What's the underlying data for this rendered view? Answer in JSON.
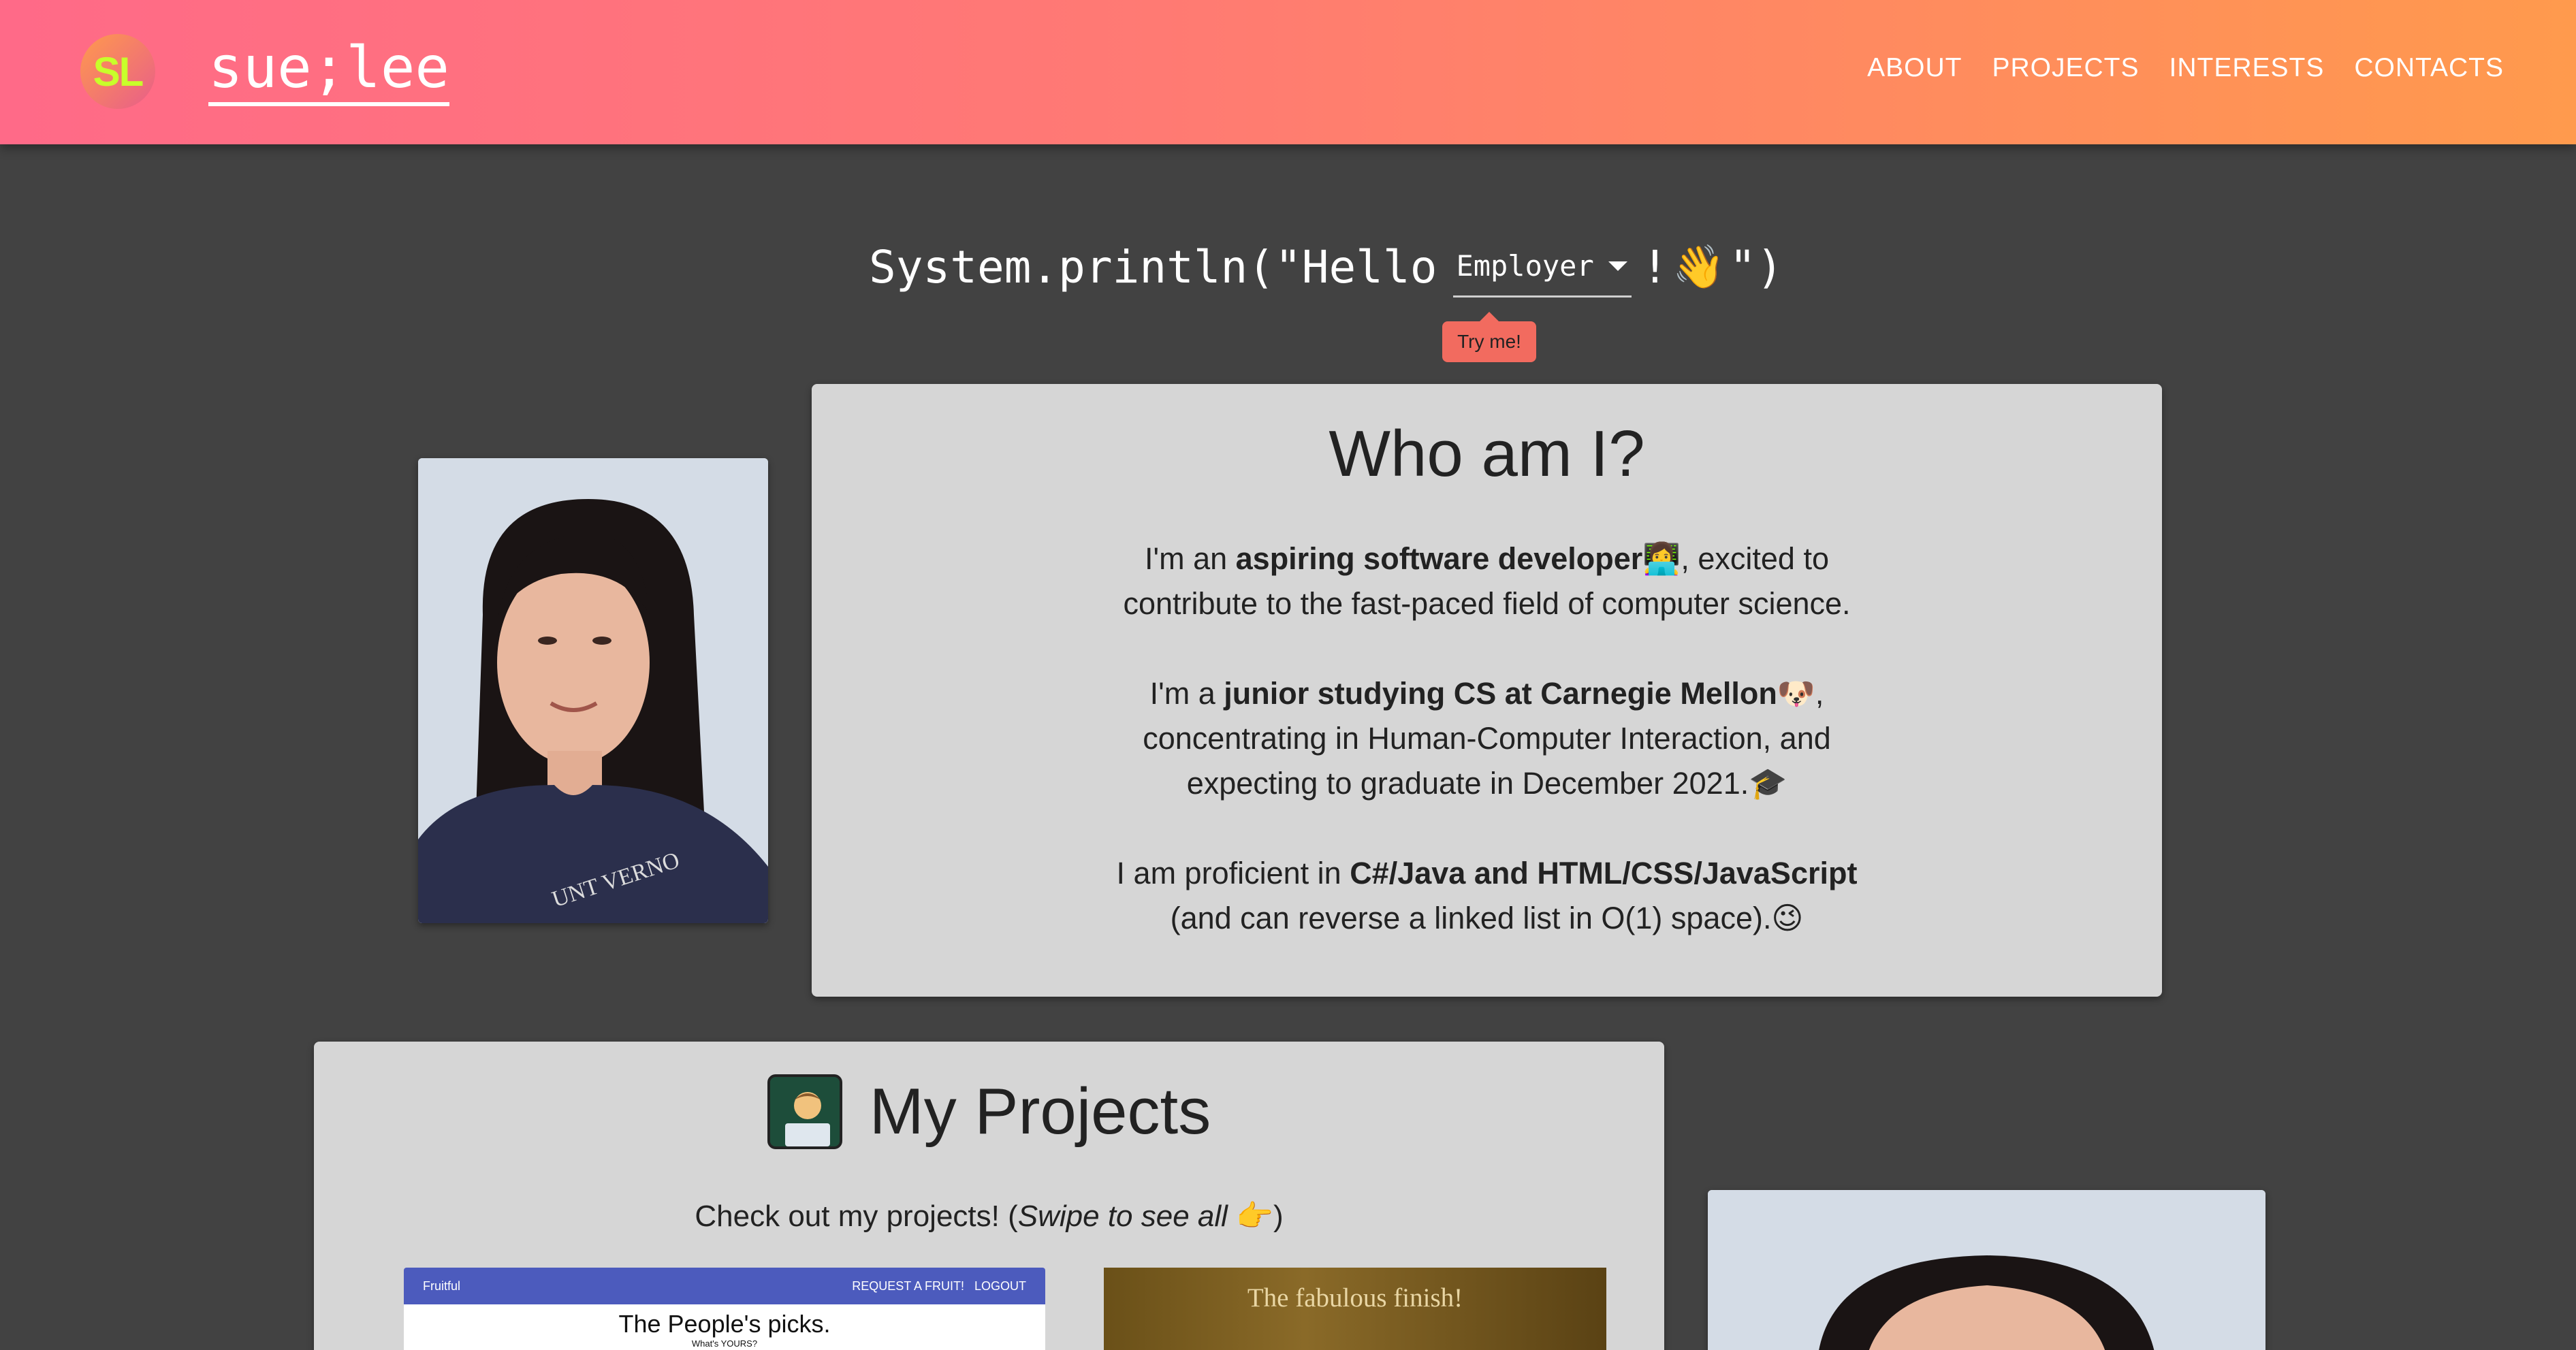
{
  "header": {
    "logo_initials": "SL",
    "brand": "sue;lee",
    "nav": [
      "ABOUT",
      "PROJECTS",
      "INTERESTS",
      "CONTACTS"
    ]
  },
  "hello": {
    "prefix": "System.println(\"Hello",
    "selected": "Employer",
    "bang": "!",
    "emoji": "👋",
    "suffix": "\")",
    "tooltip": "Try me!"
  },
  "who": {
    "title": "Who am I?",
    "p1_a": "I'm an ",
    "p1_b": "aspiring software developer",
    "p1_emoji": "👩‍💻",
    "p1_c": ", excited to",
    "p1_d": "contribute to the fast-paced field of computer science.",
    "p2_a": "I'm a ",
    "p2_b": "junior studying CS at Carnegie Mellon",
    "p2_emoji": "🐶",
    "p2_c": ",",
    "p2_d": "concentrating in Human-Computer Interaction, and",
    "p2_e": "expecting to graduate in December 2021.",
    "p2_emoji2": "🎓",
    "p3_a": "I am proficient in ",
    "p3_b": "C#/Java and HTML/CSS/JavaScript",
    "p3_c": "(and can reverse a linked list in O(1) space).",
    "p3_emoji": "😉"
  },
  "projects": {
    "title": "My Projects",
    "subtitle_a": "Check out my projects! (",
    "subtitle_em": "Swipe to see all",
    "subtitle_emoji": "👉",
    "subtitle_b": ")",
    "thumb1": {
      "app": "Fruitful",
      "action1": "REQUEST A FRUIT!",
      "action2": "LOGOUT",
      "headline": "The People's picks.",
      "sub": "What's YOURS?"
    },
    "thumb2": {
      "headline": "The fabulous finish!"
    }
  }
}
